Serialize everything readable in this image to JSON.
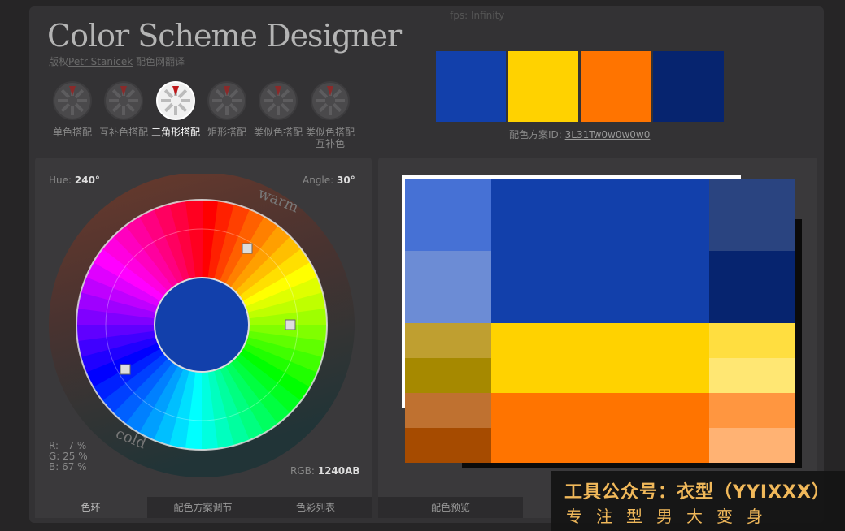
{
  "header": {
    "fps": "fps: Infinity",
    "title": "Color Scheme Designer",
    "subtitle_prefix": "版权",
    "subtitle_author": "Petr Stanicek",
    "subtitle_suffix": " 配色网翻译"
  },
  "schemes": [
    {
      "label": "单色搭配",
      "icon": "mono-scheme-icon",
      "active": false
    },
    {
      "label": "互补色搭配",
      "icon": "complement-scheme-icon",
      "active": false
    },
    {
      "label": "三角形搭配",
      "icon": "triad-scheme-icon",
      "active": true
    },
    {
      "label": "矩形搭配",
      "icon": "tetrad-scheme-icon",
      "active": false
    },
    {
      "label": "类似色搭配",
      "icon": "analogic-scheme-icon",
      "active": false
    },
    {
      "label": "类似色搭配互补色",
      "icon": "accented-analogic-scheme-icon",
      "active": false
    }
  ],
  "swatches": [
    "#1240AB",
    "#FFD200",
    "#FF7400",
    "#06246F"
  ],
  "scheme_id": {
    "label": "配色方案ID: ",
    "value": "3L31Tw0w0w0w0"
  },
  "wheel": {
    "hue_label": "Hue: ",
    "hue_value": "240°",
    "angle_label": "Angle: ",
    "angle_value": "30°",
    "warm_label": "warm",
    "cold_label": "cold",
    "r": "R:   7 %",
    "g": "G: 25 %",
    "b": "B: 67 %",
    "rgb_label": "RGB: ",
    "rgb_value": "1240AB",
    "center_color": "#1240AB"
  },
  "tabs_left": [
    {
      "label": "色环",
      "active": true
    },
    {
      "label": "配色方案调节",
      "active": false
    },
    {
      "label": "色彩列表",
      "active": false
    }
  ],
  "tab_preview": "配色预览",
  "preview_colors": {
    "primary": [
      "#1240AB",
      "#4671D5",
      "#6C8CD5",
      "#2A4480",
      "#06246F"
    ],
    "yellow": [
      "#FFD200",
      "#BF9F30",
      "#A68900",
      "#FFDE40",
      "#FFE773"
    ],
    "orange": [
      "#FF7400",
      "#BF7130",
      "#A64B00",
      "#FF9640",
      "#FFB273"
    ]
  },
  "watermark": {
    "line1": "工具公众号：衣型（YYIXXX）",
    "line2": "专注型男大变身"
  }
}
